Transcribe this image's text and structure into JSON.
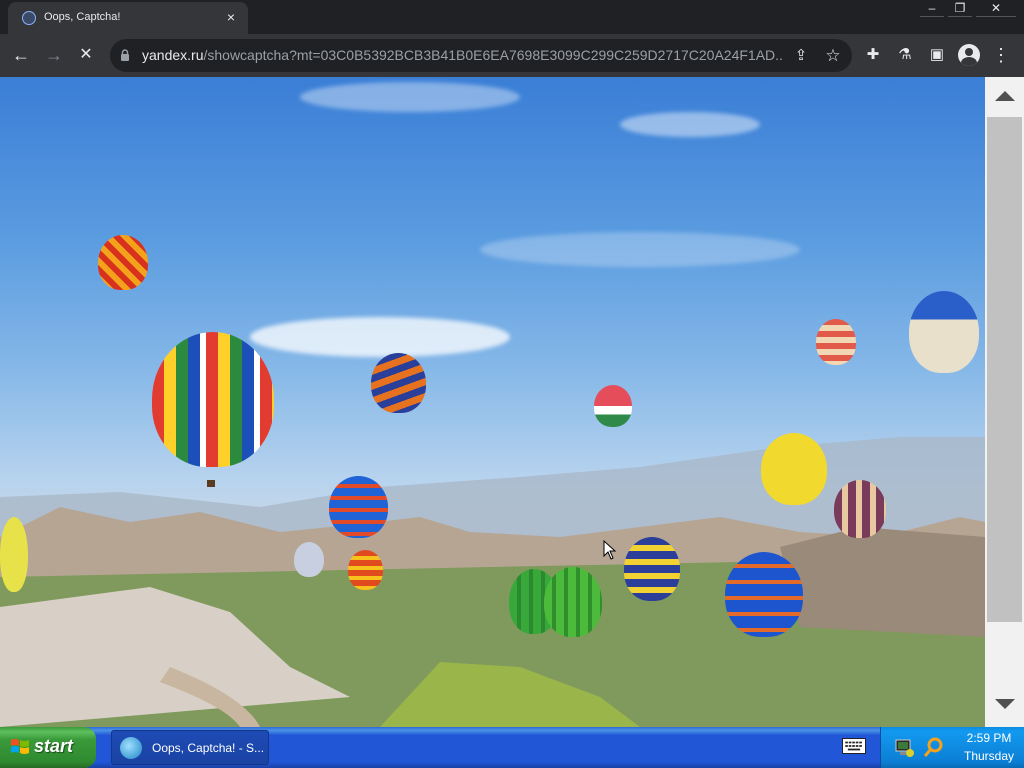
{
  "browser": {
    "tab": {
      "title": "Oops, Captcha!",
      "close": "×"
    },
    "window_controls": {
      "minimize": "–",
      "restore": "❐",
      "close": "✕"
    },
    "nav": {
      "back": "←",
      "forward": "→",
      "stop": "✕"
    },
    "url": {
      "host": "yandex.ru",
      "path": "/showcaptcha?mt=03C0B5392BCB3B41B0E6EA7698E3099C299C259D2717C20A24F1AD..."
    },
    "omnibox_icons": {
      "share": "⇪",
      "bookmark": "☆"
    },
    "toolbar_icons": {
      "extensions": "✚",
      "labs": "⚗",
      "sidepanel": "▣",
      "menu": "⋮"
    }
  },
  "content": {
    "image_description_icon": "hot-air-balloons-photo"
  },
  "taskbar": {
    "start_label": "start",
    "task_button": "Oops, Captcha! - S...",
    "clock_time": "2:59 PM",
    "clock_day": "Thursday"
  },
  "colors": {
    "tab_bg": "#35363a",
    "titlebar_bg": "#202124",
    "taskbar_blue": "#2157d7",
    "start_green": "#3a9b3a",
    "tray_blue": "#0b7ed4"
  }
}
